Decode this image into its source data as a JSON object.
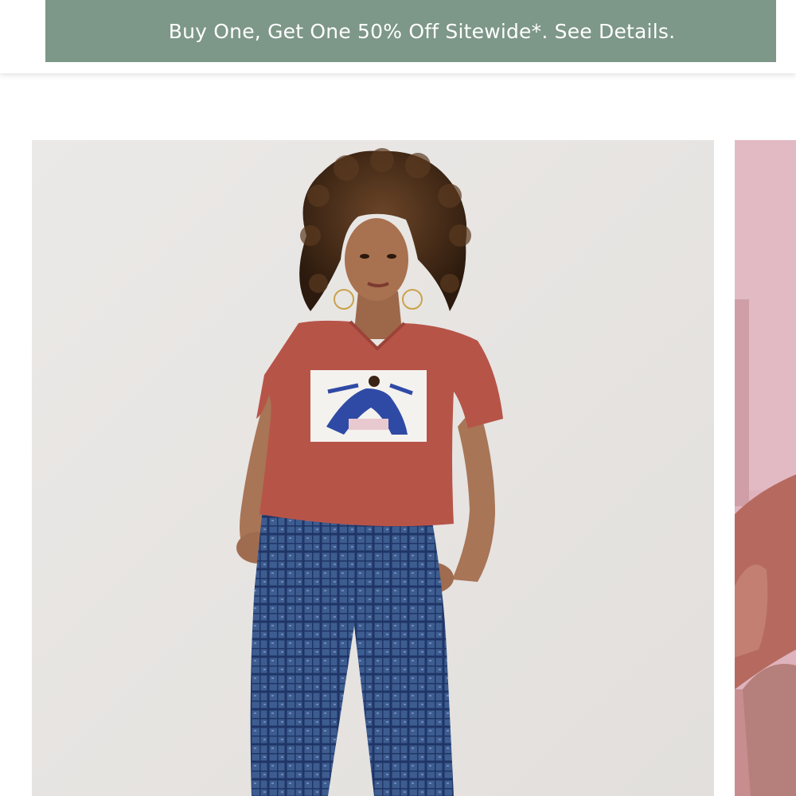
{
  "promo": {
    "text": "Buy One, Get One 50% Off Sitewide*. See Details.",
    "background_color": "#7d9788",
    "text_color": "#ffffff"
  },
  "products": [
    {
      "image": "model-in-red-graphic-v-neck-tee-and-blue-checked-jeans",
      "tee_color": "#b75448",
      "jeans_color": "#3b5a8d"
    },
    {
      "image": "partially-visible-product-photo-pink-background",
      "background_color": "#dfb3bd"
    }
  ]
}
